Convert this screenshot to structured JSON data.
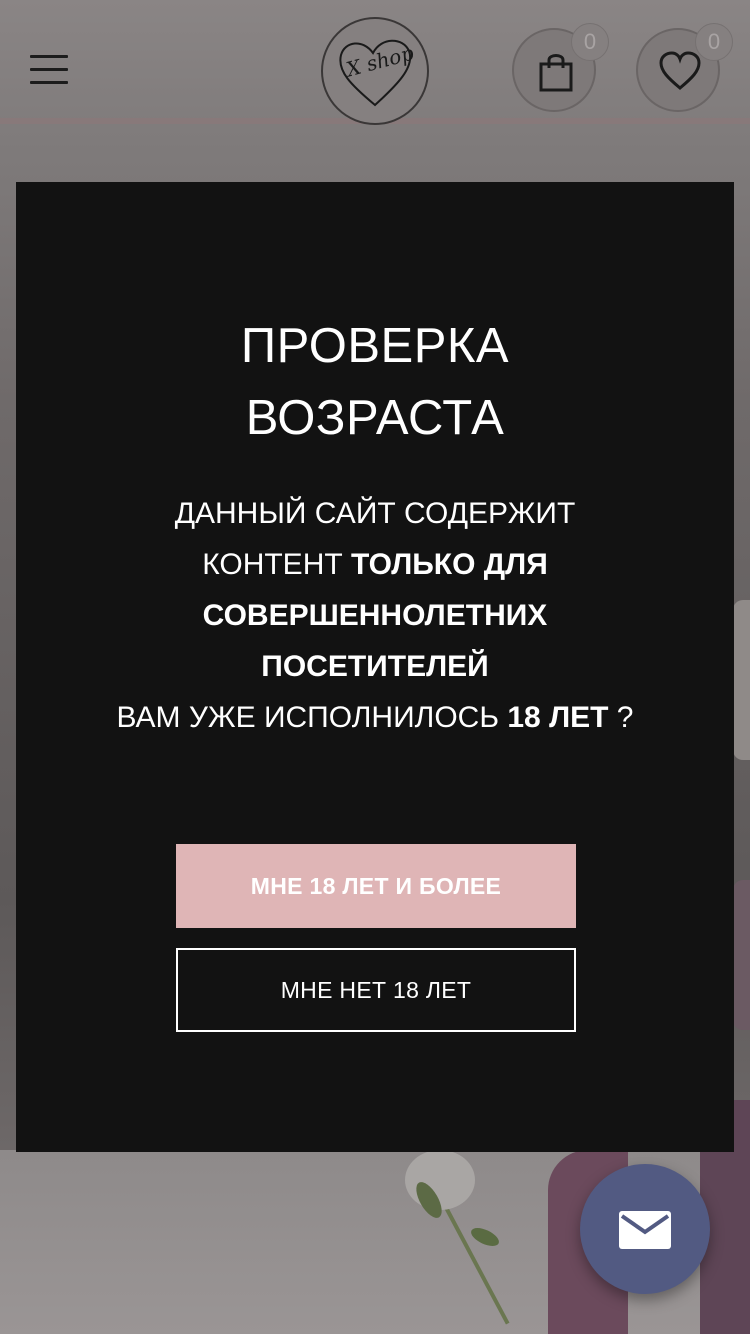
{
  "header": {
    "logo_text": "X shop",
    "cart_count": "0",
    "favorites_count": "0"
  },
  "modal": {
    "title_line1": "ПРОВЕРКА",
    "title_line2": "ВОЗРАСТА",
    "text_part1": "ДАННЫЙ САЙТ СОДЕРЖИТ КОНТЕНТ ",
    "text_bold1": "ТОЛЬКО ДЛЯ СОВЕРШЕННОЛЕТНИХ ПОСЕТИТЕЛЕЙ",
    "text_part2": "ВАМ УЖЕ ИСПОЛНИЛОСЬ ",
    "text_bold2": "18 ЛЕТ",
    "text_part3": " ?",
    "confirm_label": "МНЕ 18 ЛЕТ И БОЛЕЕ",
    "deny_label": "МНЕ НЕТ 18 ЛЕТ"
  },
  "colors": {
    "modal_bg": "#121212",
    "confirm_bg": "#dfb5b6",
    "fab_bg": "#525a82"
  },
  "icons": {
    "menu": "hamburger-icon",
    "cart": "shopping-bag-icon",
    "favorites": "heart-icon",
    "mail": "mail-icon"
  }
}
